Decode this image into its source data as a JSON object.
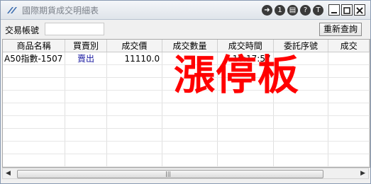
{
  "window": {
    "title": "國際期貨成交明細表"
  },
  "toolbar_icons": [
    "logout-icon",
    "info-icon",
    "print-icon",
    "help-icon",
    "font-icon"
  ],
  "window_buttons": [
    "minimize-icon",
    "maximize-icon",
    "close-icon"
  ],
  "account": {
    "label": "交易帳號",
    "value": ""
  },
  "requery_label": "重新查詢",
  "columns": [
    "商品名稱",
    "買賣別",
    "成交價",
    "成交數量",
    "成交時間",
    "委託序號",
    "成交"
  ],
  "rows": [
    {
      "product": "A50指數-1507",
      "side": "賣出",
      "price": "11110.0",
      "quantity": "",
      "time": "10:17:57",
      "order_no": "",
      "more": ""
    }
  ],
  "stamp_text": "漲停板",
  "colors": {
    "stamp": "#ff0000",
    "side_text": "#1a1aa0"
  }
}
